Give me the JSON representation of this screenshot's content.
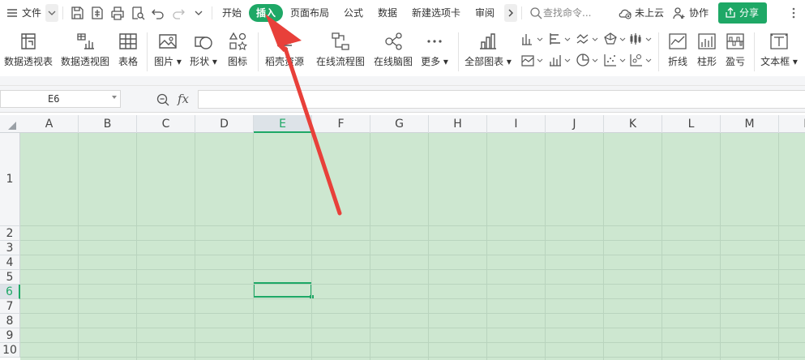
{
  "menubar": {
    "file_label": "文件",
    "tabs": [
      {
        "label": "开始"
      },
      {
        "label": "插入"
      },
      {
        "label": "页面布局"
      },
      {
        "label": "公式"
      },
      {
        "label": "数据"
      },
      {
        "label": "新建选项卡"
      },
      {
        "label": "审阅"
      }
    ],
    "search_placeholder": "查找命令...",
    "cloud_status": "未上云",
    "collab_label": "协作",
    "share_label": "分享"
  },
  "ribbon": {
    "pivot_table": "数据透视表",
    "pivot_chart": "数据透视图",
    "table": "表格",
    "picture": "图片",
    "shapes": "形状",
    "icons": "图标",
    "resources": "稻壳资源",
    "online_flowchart": "在线流程图",
    "online_mindmap": "在线脑图",
    "more": "更多",
    "all_charts": "全部图表",
    "sparkline_line": "折线",
    "sparkline_column": "柱形",
    "sparkline_winloss": "盈亏",
    "textbox": "文本框"
  },
  "formula_bar": {
    "cell_ref": "E6",
    "fx": "fx"
  },
  "sheet": {
    "columns": [
      "A",
      "B",
      "C",
      "D",
      "E",
      "F",
      "G",
      "H",
      "I",
      "J",
      "K",
      "L",
      "M",
      "N"
    ],
    "rows": [
      "1",
      "2",
      "3",
      "4",
      "5",
      "6",
      "7",
      "8",
      "9",
      "10"
    ],
    "selected_column": "E",
    "selected_row": "6"
  },
  "colors": {
    "accent": "#1ea866",
    "cell_fill": "#cde7d0",
    "annotation_arrow": "#e8403a"
  }
}
